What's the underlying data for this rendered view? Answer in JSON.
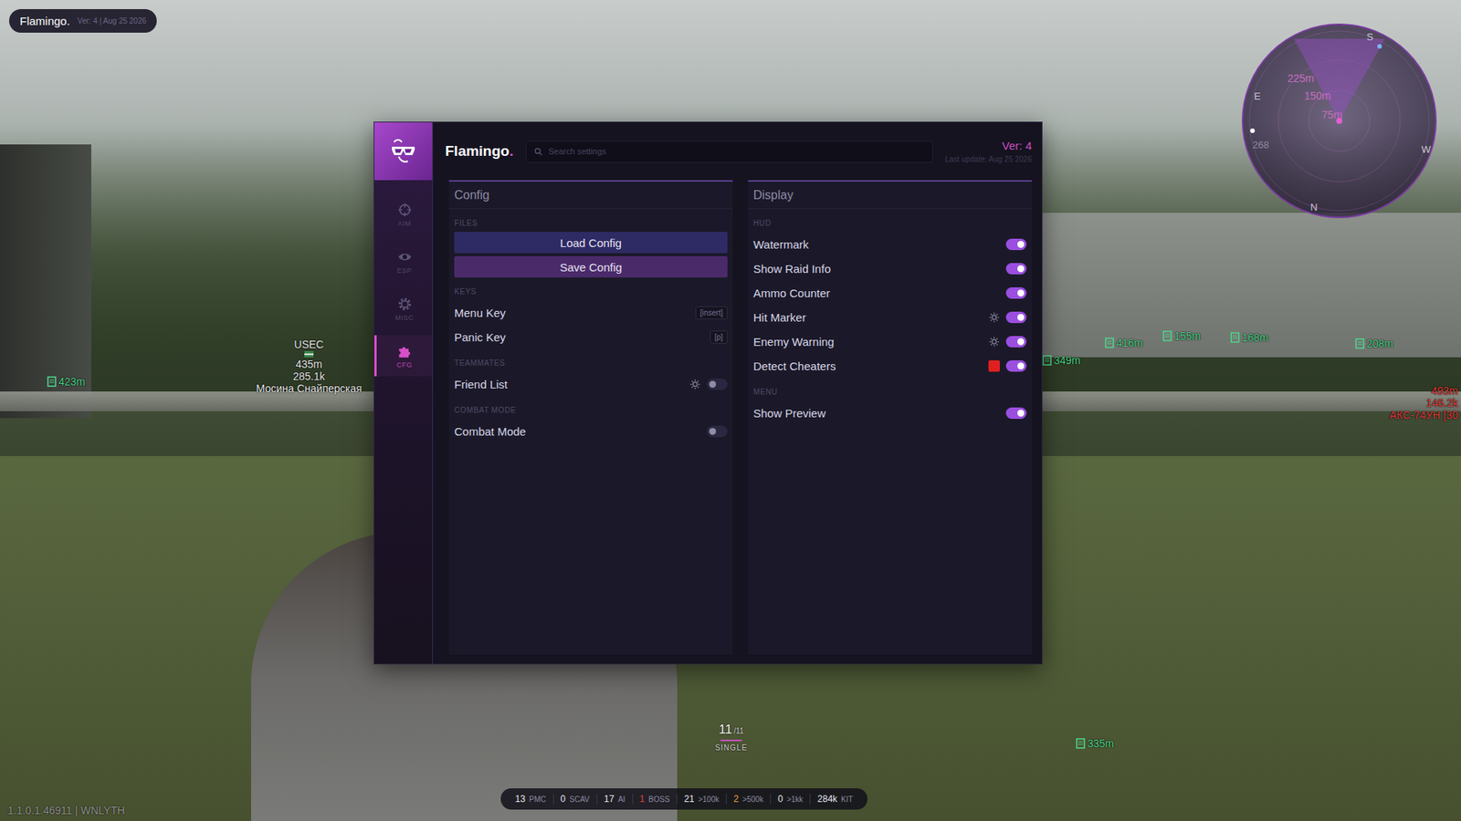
{
  "watermark": {
    "title": "Flamingo.",
    "info": "Ver: 4 | Aug 25 2026"
  },
  "menu": {
    "title": "Flamingo",
    "title_dot": ".",
    "search": {
      "placeholder": "Search settings"
    },
    "version": "Ver: 4",
    "last_update": "Last update: Aug 25 2026",
    "sidebar": {
      "items": [
        {
          "label": "AIM",
          "selected": false
        },
        {
          "label": "ESP",
          "selected": false
        },
        {
          "label": "MISC",
          "selected": false
        },
        {
          "label": "CFG",
          "selected": true
        }
      ]
    },
    "panels": [
      {
        "title": "Config",
        "sections": [
          {
            "heading": "FILES",
            "rows": [
              {
                "kind": "button",
                "label": "Load Config"
              },
              {
                "kind": "button",
                "label": "Save Config"
              }
            ]
          },
          {
            "heading": "KEYS",
            "rows": [
              {
                "kind": "key",
                "label": "Menu Key",
                "key": "[insert]"
              },
              {
                "kind": "key",
                "label": "Panic Key",
                "key": "[p]"
              }
            ]
          },
          {
            "heading": "TEAMMATES",
            "rows": [
              {
                "kind": "toggle-gear",
                "label": "Friend List",
                "on": false
              }
            ]
          },
          {
            "heading": "COMBAT MODE",
            "rows": [
              {
                "kind": "toggle",
                "label": "Combat Mode",
                "on": false
              }
            ]
          }
        ]
      },
      {
        "title": "Display",
        "sections": [
          {
            "heading": "HUD",
            "rows": [
              {
                "kind": "toggle",
                "label": "Watermark",
                "on": true
              },
              {
                "kind": "toggle",
                "label": "Show Raid Info",
                "on": true
              },
              {
                "kind": "toggle",
                "label": "Ammo Counter",
                "on": true
              },
              {
                "kind": "toggle-gear",
                "label": "Hit Marker",
                "on": true
              },
              {
                "kind": "toggle-gear",
                "label": "Enemy Warning",
                "on": true
              },
              {
                "kind": "toggle-color",
                "label": "Detect Cheaters",
                "on": true,
                "color": "#e02020"
              }
            ]
          },
          {
            "heading": "MENU",
            "rows": [
              {
                "kind": "toggle",
                "label": "Show Preview",
                "on": true
              }
            ]
          }
        ]
      }
    ]
  },
  "hud": {
    "player": {
      "faction": "USEC",
      "distance": "435m",
      "value": "285.1k",
      "weapon": "Мосина Снайперская"
    },
    "enemy": {
      "distance": "493m",
      "value": "146.2k",
      "weapon": "АКС-74УН [30"
    },
    "loot": [
      "423m",
      "416m",
      "155m",
      "168m",
      "208m",
      "349m",
      "335m"
    ],
    "ammo": {
      "count": "11",
      "max": "/11",
      "mode": "SINGLE"
    },
    "stats": [
      {
        "value": "13",
        "label": "PMC",
        "color": "#e8e6f0"
      },
      {
        "value": "0",
        "label": "SCAV",
        "color": "#e8e6f0"
      },
      {
        "value": "17",
        "label": "AI",
        "color": "#e8e6f0"
      },
      {
        "value": "1",
        "label": "BOSS",
        "color": "#e0413c"
      },
      {
        "value": "21",
        "label": ">100k",
        "color": "#e8e6f0"
      },
      {
        "value": "2",
        "label": ">500k",
        "color": "#e8a33a"
      },
      {
        "value": "0",
        "label": ">1kk",
        "color": "#e8e6f0"
      },
      {
        "value": "284k",
        "label": "KIT",
        "color": "#e8e6f0"
      }
    ],
    "build": "1.1.0.1.46911 | WNLYTH",
    "radar": {
      "rings": [
        "225m",
        "150m",
        "75m"
      ],
      "directions": [
        "S",
        "E",
        "W",
        "N"
      ],
      "bearing": "268"
    }
  }
}
